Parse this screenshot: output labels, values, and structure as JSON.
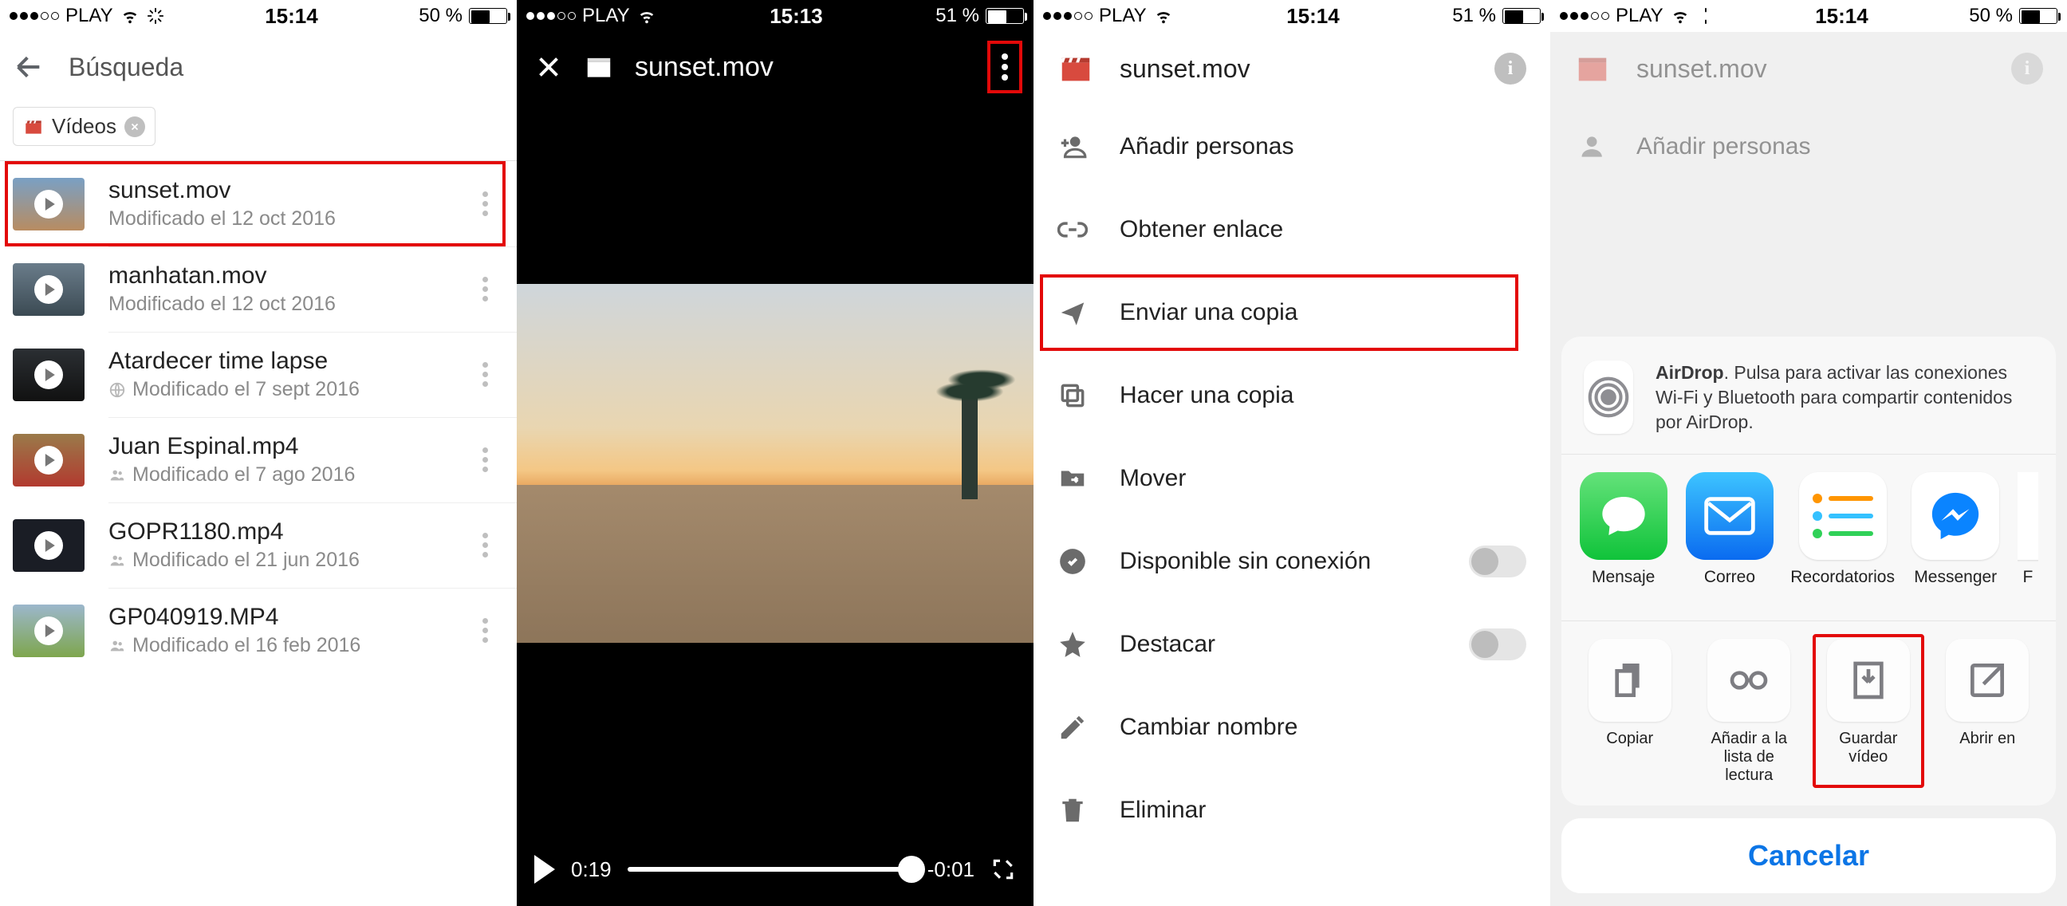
{
  "status": {
    "carrier": "PLAY",
    "p1": {
      "time": "15:14",
      "battery": "50 %"
    },
    "p2": {
      "time": "15:13",
      "battery": "51 %"
    },
    "p3": {
      "time": "15:14",
      "battery": "51 %"
    },
    "p4": {
      "time": "15:14",
      "battery": "50 %"
    }
  },
  "p1": {
    "title": "Búsqueda",
    "chip": "Vídeos",
    "items": [
      {
        "title": "sunset.mov",
        "sub": "Modificado el 12 oct 2016",
        "shared": false
      },
      {
        "title": "manhatan.mov",
        "sub": "Modificado el 12 oct 2016",
        "shared": false
      },
      {
        "title": "Atardecer time lapse",
        "sub": "Modificado el 7 sept 2016",
        "shared": "globe"
      },
      {
        "title": "Juan Espinal.mp4",
        "sub": "Modificado el 7 ago 2016",
        "shared": "people"
      },
      {
        "title": "GOPR1180.mp4",
        "sub": "Modificado el 21 jun 2016",
        "shared": "people"
      },
      {
        "title": "GP040919.MP4",
        "sub": "Modificado el 16 feb 2016",
        "shared": "people"
      }
    ]
  },
  "p2": {
    "title": "sunset.mov",
    "elapsed": "0:19",
    "remaining": "-0:01"
  },
  "p3": {
    "title": "sunset.mov",
    "actions": {
      "add_people": "Añadir personas",
      "get_link": "Obtener enlace",
      "send_copy": "Enviar una copia",
      "make_copy": "Hacer una copia",
      "move": "Mover",
      "offline": "Disponible sin conexión",
      "star": "Destacar",
      "rename": "Cambiar nombre",
      "delete": "Eliminar"
    }
  },
  "p4": {
    "title": "sunset.mov",
    "add_people": "Añadir personas",
    "airdrop_label": "AirDrop",
    "airdrop_text": ". Pulsa para activar las conexiones Wi-Fi y Bluetooth para compartir contenidos por AirDrop.",
    "apps": {
      "message": "Mensaje",
      "mail": "Correo",
      "reminders": "Recordatorios",
      "messenger": "Messenger",
      "more": "F"
    },
    "sys": {
      "copy": "Copiar",
      "reading": "Añadir a la lista de lectura",
      "save": "Guardar vídeo",
      "open": "Abrir en"
    },
    "cancel": "Cancelar"
  }
}
